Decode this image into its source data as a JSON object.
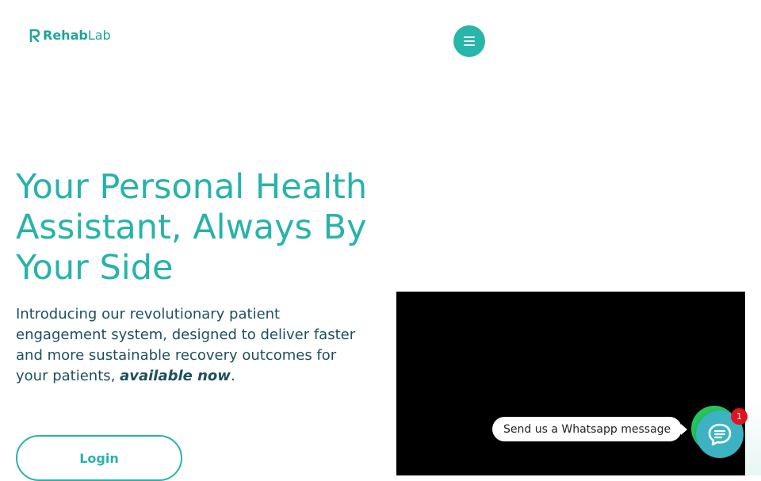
{
  "header": {
    "logo_main": "Rehab",
    "logo_suffix": "Lab",
    "menu_icon": "hamburger-icon"
  },
  "hero": {
    "title": "Your Personal Health Assistant, Always By Your Side",
    "intro": "Introducing our revolutionary patient engagement system, designed to deliver faster and more sustainable recovery outcomes for your patients, ",
    "emphasis": "available now",
    "end_punct": ".",
    "login_label": "Login"
  },
  "chat": {
    "whatsapp_prompt": "Send us a Whatsapp message",
    "badge_count": "1",
    "chat_icon": "chat-bubble-icon"
  },
  "colors": {
    "accent": "#27b3a9",
    "body_text": "#1e4f5e",
    "whatsapp": "#25c55a",
    "chat_button": "#3bb3c2",
    "badge": "#e0141e"
  }
}
